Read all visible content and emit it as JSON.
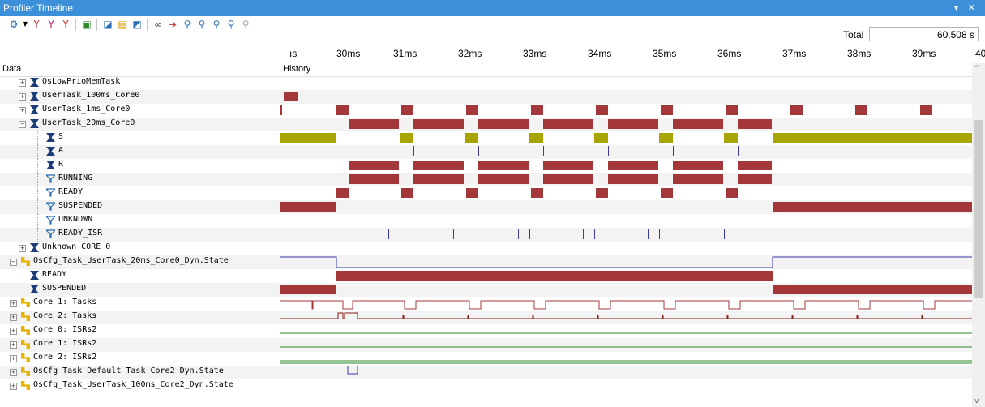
{
  "window": {
    "title": "Profiler Timeline",
    "controls": "▾ ✕"
  },
  "toolbar": {
    "icons": [
      "gear-icon",
      "filter-icon",
      "filter-red-icon",
      "filter-clear-icon",
      "export-icon",
      "chart-icon",
      "report-icon",
      "graph-icon",
      "binoculars-icon",
      "cursor-icon",
      "zoom-in-icon",
      "zoom-out-icon",
      "zoom-fit-icon",
      "zoom-prev-icon",
      "zoom-next-icon"
    ],
    "total_label": "Total",
    "total_value": "60.508 s"
  },
  "ruler": {
    "labels": [
      "ıs",
      "30ms",
      "31ms",
      "32ms",
      "33ms",
      "34ms",
      "35ms",
      "36ms",
      "37ms",
      "38ms",
      "39ms",
      "40"
    ]
  },
  "columns": {
    "data": "Data",
    "history": "History"
  },
  "tree": [
    {
      "label": "OsLowPrioMemTask",
      "indent": 0,
      "icon": "task",
      "expander": "+"
    },
    {
      "label": "UserTask_100ms_Core0",
      "indent": 0,
      "icon": "task",
      "expander": "+"
    },
    {
      "label": "UserTask_1ms_Core0",
      "indent": 0,
      "icon": "task",
      "expander": "+"
    },
    {
      "label": "UserTask_20ms_Core0",
      "indent": 0,
      "icon": "task",
      "expander": "−"
    },
    {
      "label": "S",
      "indent": 1,
      "icon": "task",
      "expander": ""
    },
    {
      "label": "A",
      "indent": 1,
      "icon": "task",
      "expander": ""
    },
    {
      "label": "R",
      "indent": 1,
      "icon": "task",
      "expander": ""
    },
    {
      "label": "RUNNING",
      "indent": 1,
      "icon": "filter",
      "expander": ""
    },
    {
      "label": "READY",
      "indent": 1,
      "icon": "filter",
      "expander": ""
    },
    {
      "label": "SUSPENDED",
      "indent": 1,
      "icon": "filter",
      "expander": ""
    },
    {
      "label": "UNKNOWN",
      "indent": 1,
      "icon": "filter",
      "expander": ""
    },
    {
      "label": "READY_ISR",
      "indent": 1,
      "icon": "filter",
      "expander": ""
    },
    {
      "label": "Unknown_CORE_0",
      "indent": 0,
      "icon": "task",
      "expander": "+"
    },
    {
      "label": "OsCfg_Task_UserTask_20ms_Core0_Dyn.State",
      "indent": -1,
      "icon": "group",
      "expander": "−"
    },
    {
      "label": "READY",
      "indent": 0,
      "icon": "task",
      "expander": ""
    },
    {
      "label": "SUSPENDED",
      "indent": 0,
      "icon": "task",
      "expander": ""
    },
    {
      "label": "Core 1: Tasks",
      "indent": -1,
      "icon": "group",
      "expander": "+"
    },
    {
      "label": "Core 2: Tasks",
      "indent": -1,
      "icon": "group",
      "expander": "+"
    },
    {
      "label": "Core 0: ISRs2",
      "indent": -1,
      "icon": "group",
      "expander": "+"
    },
    {
      "label": "Core 1: ISRs2",
      "indent": -1,
      "icon": "group",
      "expander": "+"
    },
    {
      "label": "Core 2: ISRs2",
      "indent": -1,
      "icon": "group",
      "expander": "+"
    },
    {
      "label": "OsCfg_Task_Default_Task_Core2_Dyn.State",
      "indent": -1,
      "icon": "group",
      "expander": "+"
    },
    {
      "label": "OsCfg_Task_UserTask_100ms_Core2_Dyn.State",
      "indent": -1,
      "icon": "group",
      "expander": "+"
    }
  ],
  "colors": {
    "red": "#a4373a",
    "olive": "#a8a400",
    "blue": "#3a3aa0",
    "green": "#2a8a2a",
    "darkred": "#8b1a1a",
    "title": "#3c8fd9"
  }
}
